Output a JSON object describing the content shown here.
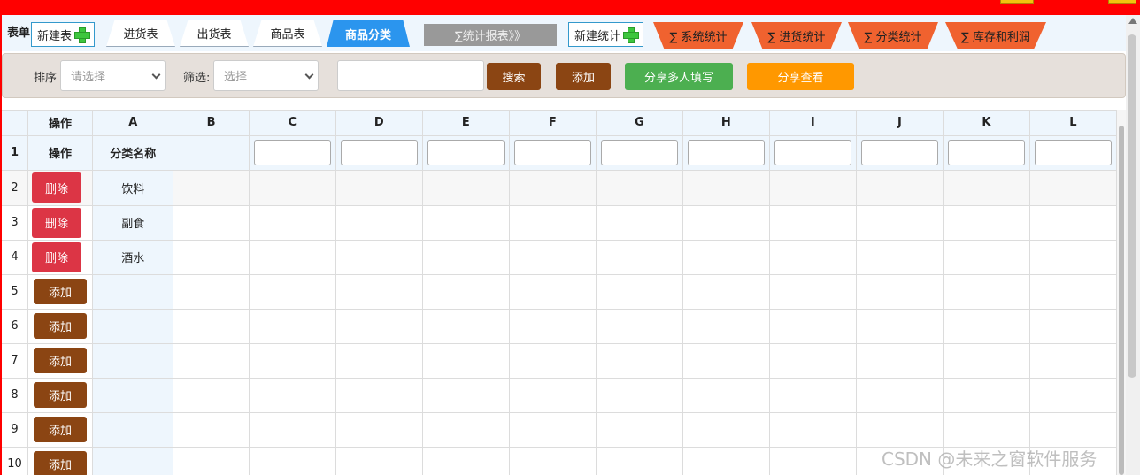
{
  "window": {
    "title": "",
    "accent": "#ff0000"
  },
  "tabbar": {
    "label": "表单",
    "new_table": "新建表",
    "tabs": [
      {
        "label": "进货表"
      },
      {
        "label": "出货表"
      },
      {
        "label": "商品表"
      },
      {
        "label": "商品分类"
      }
    ],
    "report_tab": "∑统计报表》》",
    "new_stat": "新建统计",
    "stats": [
      {
        "label": "∑ 系统统计"
      },
      {
        "label": "∑ 进货统计"
      },
      {
        "label": "∑ 分类统计"
      },
      {
        "label": "∑ 库存和利润"
      }
    ]
  },
  "toolbar": {
    "sort_label": "排序",
    "sort_placeholder": "请选择",
    "filter_label": "筛选:",
    "filter_placeholder": "选择",
    "search_value": "",
    "search_btn": "搜索",
    "add_btn": "添加",
    "share_fill_btn": "分享多人填写",
    "share_view_btn": "分享查看"
  },
  "grid": {
    "corner": "",
    "op_header": "操作",
    "columns": [
      "A",
      "B",
      "C",
      "D",
      "E",
      "F",
      "G",
      "H",
      "I",
      "J",
      "K",
      "L"
    ],
    "header_row": {
      "num": "1",
      "op": "操作",
      "a": "分类名称"
    },
    "rows": [
      {
        "num": "2",
        "action": "删除",
        "a": "饮料"
      },
      {
        "num": "3",
        "action": "删除",
        "a": "副食"
      },
      {
        "num": "4",
        "action": "删除",
        "a": "酒水"
      },
      {
        "num": "5",
        "action": "添加",
        "a": ""
      },
      {
        "num": "6",
        "action": "添加",
        "a": ""
      },
      {
        "num": "7",
        "action": "添加",
        "a": ""
      },
      {
        "num": "8",
        "action": "添加",
        "a": ""
      },
      {
        "num": "9",
        "action": "添加",
        "a": ""
      },
      {
        "num": "10",
        "action": "添加",
        "a": ""
      }
    ]
  },
  "watermark": "CSDN @未来之窗软件服务",
  "colors": {
    "tab_active": "#2b95ee",
    "stat_tab": "#f0622f",
    "delete": "#dc3545",
    "brown": "#8b4513",
    "green": "#4caf50",
    "orange": "#ff9800"
  }
}
